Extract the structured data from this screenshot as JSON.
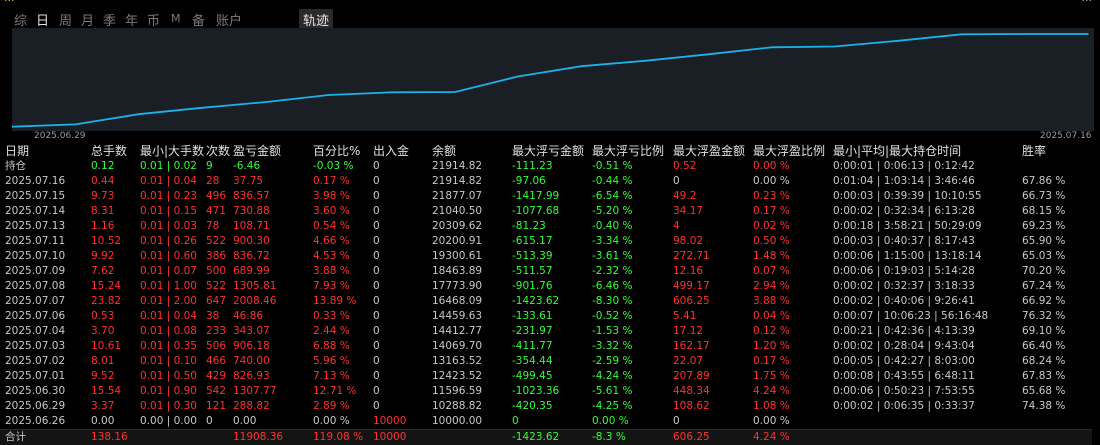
{
  "top": {
    "left_text": "...",
    "right_text": "..."
  },
  "tabs": [
    {
      "label": "综",
      "active": false
    },
    {
      "label": "日",
      "active": true
    },
    {
      "label": "周",
      "active": false
    },
    {
      "label": "月",
      "active": false
    },
    {
      "label": "季",
      "active": false
    },
    {
      "label": "年",
      "active": false
    },
    {
      "label": "币",
      "active": false
    },
    {
      "label": "M",
      "active": false
    },
    {
      "label": "备",
      "active": false
    },
    {
      "label": "账户",
      "active": false
    }
  ],
  "track_label": "轨迹",
  "colors": {
    "line": "#1ab2e8",
    "chart_bg": "#1a1e25",
    "positive": "#ff3030",
    "negative": "#30ff30"
  },
  "chart_data": {
    "type": "line",
    "x": [
      "2025.06.26",
      "2025.06.29",
      "2025.06.30",
      "2025.07.01",
      "2025.07.02",
      "2025.07.03",
      "2025.07.04",
      "2025.07.06",
      "2025.07.07",
      "2025.07.08",
      "2025.07.09",
      "2025.07.10",
      "2025.07.11",
      "2025.07.13",
      "2025.07.14",
      "2025.07.15",
      "2025.07.16",
      "2025.07.16"
    ],
    "y": [
      10000,
      10288.82,
      11596.59,
      12423.52,
      13163.52,
      14069.7,
      14412.77,
      14459.63,
      16468.09,
      17773.9,
      18463.89,
      19300.61,
      20200.91,
      20309.62,
      21040.5,
      21877.07,
      21914.82,
      21914.82
    ],
    "x_tick_labels": [
      "2025.06.29",
      "2025.07.16"
    ],
    "ylim": [
      9700,
      22300
    ]
  },
  "table": {
    "headers": [
      "日期",
      "总手数",
      "最小|大手数",
      "次数",
      "盈亏金额",
      "百分比%",
      "出入金",
      "余额",
      "最大浮亏金额",
      "最大浮亏比例",
      "最大浮盈金额",
      "最大浮盈比例",
      "最小|平均|最大持仓时间",
      "胜率"
    ],
    "holding": [
      "持仓",
      "0.12",
      "0.01 | 0.02",
      "9",
      "-6.46",
      "-0.03 %",
      "0",
      "21914.82",
      "-111.23",
      "-0.51 %",
      "0.52",
      "0.00 %",
      "0:00:01 | 0:06:13 | 0:12:42",
      ""
    ],
    "rows": [
      [
        "2025.07.16",
        "0.44",
        "0.01 | 0.04",
        "28",
        "37.75",
        "0.17 %",
        "0",
        "21914.82",
        "-97.06",
        "-0.44 %",
        "0",
        "0.00 %",
        "0:01:04 | 1:03:14 | 3:46:46",
        "67.86 %"
      ],
      [
        "2025.07.15",
        "9.73",
        "0.01 | 0.23",
        "496",
        "836.57",
        "3.98 %",
        "0",
        "21877.07",
        "-1417.99",
        "-6.54 %",
        "49.2",
        "0.23 %",
        "0:00:03 | 0:39:39 | 10:10:55",
        "66.73 %"
      ],
      [
        "2025.07.14",
        "8.31",
        "0.01 | 0.15",
        "471",
        "730.88",
        "3.60 %",
        "0",
        "21040.50",
        "-1077.68",
        "-5.20 %",
        "34.17",
        "0.17 %",
        "0:00:02 | 0:32:34 | 6:13:28",
        "68.15 %"
      ],
      [
        "2025.07.13",
        "1.16",
        "0.01 | 0.03",
        "78",
        "108.71",
        "0.54 %",
        "0",
        "20309.62",
        "-81.23",
        "-0.40 %",
        "4",
        "0.02 %",
        "0:00:18 | 3:58:21 | 50:29:09",
        "69.23 %"
      ],
      [
        "2025.07.11",
        "10.52",
        "0.01 | 0.26",
        "522",
        "900.30",
        "4.66 %",
        "0",
        "20200.91",
        "-615.17",
        "-3.34 %",
        "98.02",
        "0.50 %",
        "0:00:03 | 0:40:37 | 8:17:43",
        "65.90 %"
      ],
      [
        "2025.07.10",
        "9.92",
        "0.01 | 0.60",
        "386",
        "836.72",
        "4.53 %",
        "0",
        "19300.61",
        "-513.39",
        "-3.61 %",
        "272.71",
        "1.48 %",
        "0:00:06 | 1:15:00 | 13:18:14",
        "65.03 %"
      ],
      [
        "2025.07.09",
        "7.62",
        "0.01 | 0.07",
        "500",
        "689.99",
        "3.88 %",
        "0",
        "18463.89",
        "-511.57",
        "-2.32 %",
        "12.16",
        "0.07 %",
        "0:00:06 | 0:19:03 | 5:14:28",
        "70.20 %"
      ],
      [
        "2025.07.08",
        "15.24",
        "0.01 | 1.00",
        "522",
        "1305.81",
        "7.93 %",
        "0",
        "17773.90",
        "-901.76",
        "-6.46 %",
        "499.17",
        "2.94 %",
        "0:00:02 | 0:32:37 | 3:18:33",
        "67.24 %"
      ],
      [
        "2025.07.07",
        "23.82",
        "0.01 | 2.00",
        "647",
        "2008.46",
        "13.89 %",
        "0",
        "16468.09",
        "-1423.62",
        "-8.30 %",
        "606.25",
        "3.88 %",
        "0:00:02 | 0:40:06 | 9:26:41",
        "66.92 %"
      ],
      [
        "2025.07.06",
        "0.53",
        "0.01 | 0.04",
        "38",
        "46.86",
        "0.33 %",
        "0",
        "14459.63",
        "-133.61",
        "-0.52 %",
        "5.41",
        "0.04 %",
        "0:00:07 | 10:06:23 | 56:16:48",
        "76.32 %"
      ],
      [
        "2025.07.04",
        "3.70",
        "0.01 | 0.08",
        "233",
        "343.07",
        "2.44 %",
        "0",
        "14412.77",
        "-231.97",
        "-1.53 %",
        "17.12",
        "0.12 %",
        "0:00:21 | 0:42:36 | 4:13:39",
        "69.10 %"
      ],
      [
        "2025.07.03",
        "10.61",
        "0.01 | 0.35",
        "506",
        "906.18",
        "6.88 %",
        "0",
        "14069.70",
        "-411.77",
        "-3.32 %",
        "162.17",
        "1.20 %",
        "0:00:02 | 0:28:04 | 9:43:04",
        "66.40 %"
      ],
      [
        "2025.07.02",
        "8.01",
        "0.01 | 0.10",
        "466",
        "740.00",
        "5.96 %",
        "0",
        "13163.52",
        "-354.44",
        "-2.59 %",
        "22.07",
        "0.17 %",
        "0:00:05 | 0:42:27 | 8:03:00",
        "68.24 %"
      ],
      [
        "2025.07.01",
        "9.52",
        "0.01 | 0.50",
        "429",
        "826.93",
        "7.13 %",
        "0",
        "12423.52",
        "-499.45",
        "-4.24 %",
        "207.89",
        "1.75 %",
        "0:00:08 | 0:43:55 | 6:48:11",
        "67.83 %"
      ],
      [
        "2025.06.30",
        "15.54",
        "0.01 | 0.90",
        "542",
        "1307.77",
        "12.71 %",
        "0",
        "11596.59",
        "-1023.36",
        "-5.61 %",
        "448.34",
        "4.24 %",
        "0:00:06 | 0:50:23 | 7:53:55",
        "65.68 %"
      ],
      [
        "2025.06.29",
        "3.37",
        "0.01 | 0.30",
        "121",
        "288.82",
        "2.89 %",
        "0",
        "10288.82",
        "-420.35",
        "-4.25 %",
        "108.62",
        "1.08 %",
        "0:00:02 | 0:06:35 | 0:33:37",
        "74.38 %"
      ],
      [
        "2025.06.26",
        "0.00",
        "0.00 | 0.00",
        "0",
        "0.00",
        "0.00 %",
        "10000",
        "10000.00",
        "0",
        "0.00 %",
        "0",
        "0.00 %",
        "",
        ""
      ]
    ],
    "total": [
      "合计",
      "138.16",
      "",
      "",
      "11908.36",
      "119.08 %",
      "10000",
      "",
      "-1423.62",
      "-8.3 %",
      "606.25",
      "4.24 %",
      "",
      ""
    ]
  }
}
